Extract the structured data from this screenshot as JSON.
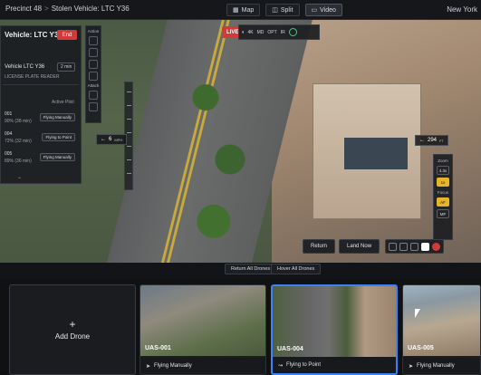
{
  "topbar": {
    "crumb_precinct": "Precinct 48",
    "crumb_sep": ">",
    "crumb_vehicle": "Stolen Vehicle: LTC Y36",
    "tabs": [
      {
        "label": "Map",
        "icon": "map-icon"
      },
      {
        "label": "Split",
        "icon": "split-icon"
      },
      {
        "label": "Video",
        "icon": "video-icon",
        "active": true
      }
    ],
    "city": "New York"
  },
  "video": {
    "live_label": "LIVE",
    "controls": [
      "4K",
      "MD",
      "OPT",
      "IR"
    ],
    "heading_left_value": "6",
    "heading_left_unit": "MPH",
    "heading_right_value": "294",
    "heading_right_unit": "FT"
  },
  "left_panel": {
    "title": "Vehicle: LTC Y36",
    "end_label": "End",
    "subject": "Vehicle LTC Y36",
    "subject_badge": "2 min",
    "subject_source": "LICENSE PLATE READER",
    "pilot_header": "Active Pilot",
    "rows": [
      {
        "id": "001",
        "battery": "90% (38 min)",
        "status": "Flying Manually"
      },
      {
        "id": "004",
        "battery": "72% (32 min)",
        "status": "Flying to Point"
      },
      {
        "id": "005",
        "battery": "89% (36 min)",
        "status": "Flying Manually"
      }
    ]
  },
  "toolstrip": {
    "label_top": "Action",
    "label_mid": "Attach"
  },
  "camera_controls": {
    "zoom_label": "Zoom",
    "zoom_value": "4.3x",
    "zoom_btn": "1x",
    "focus_label": "Focus",
    "focus_af": "AF",
    "focus_mf": "MF"
  },
  "bottom_controls": {
    "return_label": "Return",
    "land_label": "Land Now",
    "stop_label": "STOP"
  },
  "fleet": {
    "return_all": "Return All Drones",
    "hover_all": "Hover All Drones"
  },
  "cards": {
    "add_label": "Add Drone",
    "add_plus": "+",
    "drones": [
      {
        "name": "UAS-001",
        "status": "Flying Manually"
      },
      {
        "name": "UAS-004",
        "status": "Flying to Point"
      },
      {
        "name": "UAS-005",
        "status": "Flying Manually"
      }
    ]
  },
  "colors": {
    "accent_red": "#d23a3a",
    "selection_blue": "#3b82f6",
    "zoom_yellow": "#e5b42b"
  }
}
